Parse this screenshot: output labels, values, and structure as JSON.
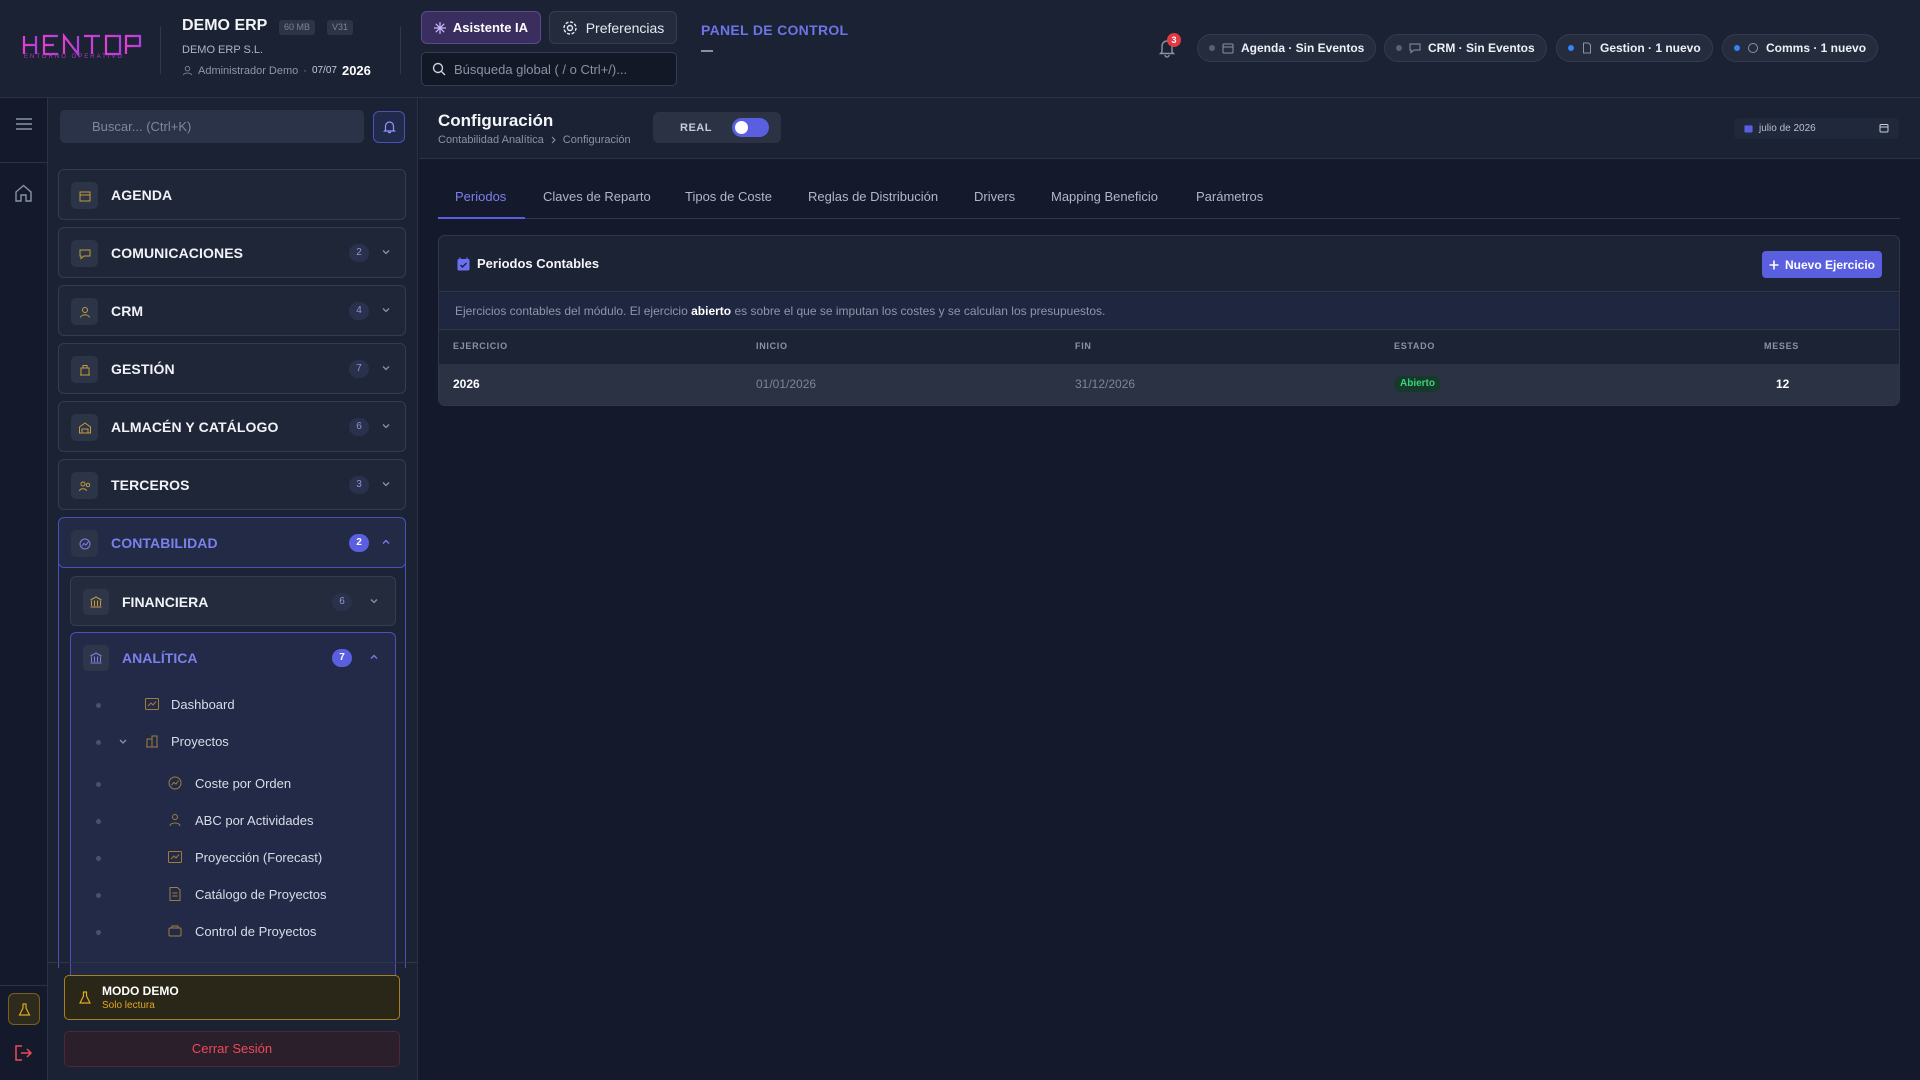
{
  "header": {
    "logo_text": "HENTOP",
    "logo_sub": "ENTORNO OPERATIVO",
    "app_name": "DEMO ERP",
    "tag_size": "60 MB",
    "tag_version": "V31",
    "company": "DEMO ERP S.L.",
    "user": "Administrador Demo",
    "separator": "·",
    "date": "07/07",
    "year": "2026",
    "ai_button": "Asistente IA",
    "prefs_button": "Preferencias",
    "search_placeholder": "Búsqueda global ( / o Ctrl+/)...",
    "panel_title": "PANEL DE CONTROL",
    "notifications_count": "3",
    "chips": [
      {
        "label": "Agenda · Sin Eventos",
        "icon": "calendar-icon",
        "dot": "#596175"
      },
      {
        "label": "CRM · Sin Eventos",
        "icon": "chat-icon",
        "dot": "#596175"
      },
      {
        "label": "Gestion · 1 nuevo",
        "icon": "document-icon",
        "dot": "#3b82f6"
      },
      {
        "label": "Comms · 1 nuevo",
        "icon": "message-icon",
        "dot": "#3b82f6"
      }
    ]
  },
  "sidebar": {
    "search_placeholder": "Buscar... (Ctrl+K)",
    "modules": [
      {
        "label": "AGENDA",
        "count": ""
      },
      {
        "label": "COMUNICACIONES",
        "count": "2"
      },
      {
        "label": "CRM",
        "count": "4"
      },
      {
        "label": "GESTIÓN",
        "count": "7"
      },
      {
        "label": "ALMACÉN Y CATÁLOGO",
        "count": "6"
      },
      {
        "label": "TERCEROS",
        "count": "3"
      },
      {
        "label": "CONTABILIDAD",
        "count": "2"
      }
    ],
    "submodules": [
      {
        "label": "FINANCIERA",
        "count": "6"
      },
      {
        "label": "ANALÍTICA",
        "count": "7"
      }
    ],
    "leaves": [
      {
        "label": "Dashboard"
      },
      {
        "label": "Proyectos"
      },
      {
        "label": "Coste por Orden"
      },
      {
        "label": "ABC por Actividades"
      },
      {
        "label": "Proyección (Forecast)"
      },
      {
        "label": "Catálogo de Proyectos"
      },
      {
        "label": "Control de Proyectos"
      }
    ],
    "demo_title": "MODO DEMO",
    "demo_sub": "Solo lectura",
    "logout": "Cerrar Sesión"
  },
  "main": {
    "title": "Configuración",
    "breadcrumb": [
      "Contabilidad Analítica",
      "Configuración"
    ],
    "mode_label": "REAL",
    "mode_on": true,
    "date_picker": "julio de 2026",
    "tabs": [
      "Periodos",
      "Claves de Reparto",
      "Tipos de Coste",
      "Reglas de Distribución",
      "Drivers",
      "Mapping Beneficio",
      "Parámetros"
    ],
    "active_tab": 0,
    "card_title": "Periodos Contables",
    "new_button": "Nuevo Ejercicio",
    "desc_before": "Ejercicios contables del módulo. El ejercicio ",
    "desc_bold": "abierto",
    "desc_after": " es sobre el que se imputan los costes y se calculan los presupuestos.",
    "columns": [
      "EJERCICIO",
      "INICIO",
      "FIN",
      "ESTADO",
      "MESES"
    ],
    "rows": [
      {
        "ejercicio": "2026",
        "inicio": "01/01/2026",
        "fin": "31/12/2026",
        "estado": "Abierto",
        "meses": "12"
      }
    ]
  },
  "colors": {
    "accent": "#5a5fe0",
    "accent_text": "#7b80ec",
    "brand_magenta": "#e23fd0",
    "status_open": "#3ed17d",
    "danger": "#ef4a55",
    "warning": "#e0a820"
  }
}
